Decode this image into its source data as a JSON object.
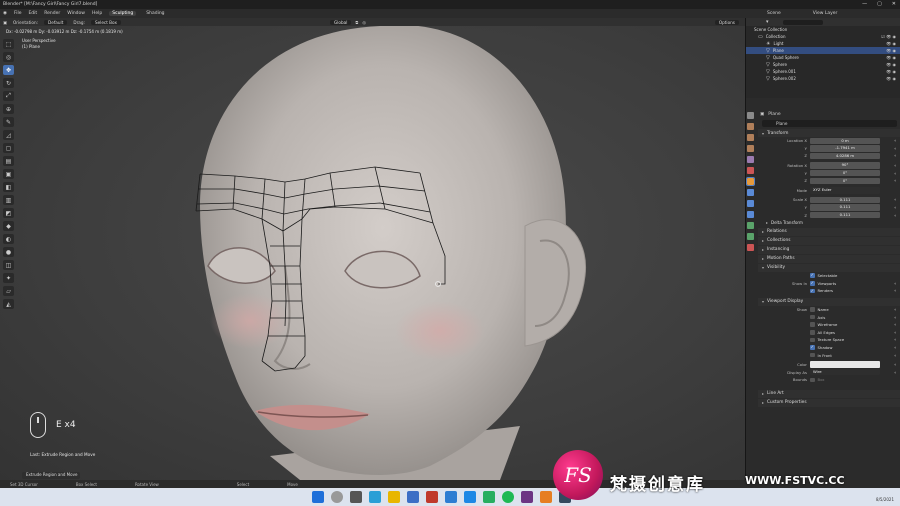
{
  "window": {
    "title": "Blender* [M:\\Fancy Girl\\Fancy Girl7.blend]",
    "controls": [
      "—",
      "▢",
      "✕"
    ]
  },
  "menu": {
    "items": [
      "File",
      "Edit",
      "Render",
      "Window",
      "Help"
    ],
    "workspaces": [
      "Sculpting",
      "Shading"
    ],
    "active_workspace": "Sculpting"
  },
  "scene_header": {
    "scene": "Scene",
    "view_layer": "View Layer"
  },
  "tool_header": {
    "orientation_label": "Orientation:",
    "orientation_value": "Default",
    "drag_label": "Drag:",
    "drag_value": "Select Box",
    "transform_orient": "Global",
    "options_label": "Options"
  },
  "viewport": {
    "status_top": "Dx: -0.02798 m   Dy: -0.03912 m   Dz: -0.1754 m (0.1819 m)",
    "perspective": "User Perspective",
    "object": "(1) Plane",
    "keycast": "E x4",
    "last_op": "Last: Extrude Region and Move",
    "op_panel": "Extrude Region and Move"
  },
  "footer": {
    "items": [
      "Set 3D Cursor",
      "Box Select",
      "Rotate View",
      "Select",
      "Move"
    ]
  },
  "outliner": {
    "root": "Scene Collection",
    "collection": "Collection",
    "items": [
      {
        "name": "Light",
        "selected": false
      },
      {
        "name": "Plane",
        "selected": true
      },
      {
        "name": "Quad Sphere",
        "selected": false
      },
      {
        "name": "Sphere",
        "selected": false
      },
      {
        "name": "Sphere.001",
        "selected": false
      },
      {
        "name": "Sphere.002",
        "selected": false
      }
    ]
  },
  "properties": {
    "header_object": "Plane",
    "object_name": "Plane",
    "transform": {
      "title": "Transform",
      "location": {
        "label": "Location X",
        "x": "0 m",
        "y": "-1.7941 m",
        "z": "4.0286 m"
      },
      "rotation": {
        "label": "Rotation X",
        "x": "90°",
        "y": "0°",
        "z": "0°"
      },
      "mode_label": "Mode",
      "mode": "XYZ Euler",
      "scale": {
        "label": "Scale X",
        "x": "0.111",
        "y": "0.111",
        "z": "0.111"
      },
      "axis_y": "Y",
      "axis_z": "Z",
      "delta": "Delta Transform"
    },
    "panels": [
      "Relations",
      "Collections",
      "Instancing",
      "Motion Paths"
    ],
    "visibility": {
      "title": "Visibility",
      "selectable": "Selectable",
      "show_in_label": "Show In",
      "viewports": "Viewports",
      "renders": "Renders"
    },
    "viewport_display": {
      "title": "Viewport Display",
      "show_label": "Show",
      "options": [
        {
          "label": "Name",
          "on": false
        },
        {
          "label": "Axis",
          "on": false
        },
        {
          "label": "Wireframe",
          "on": false
        },
        {
          "label": "All Edges",
          "on": false
        },
        {
          "label": "Texture Space",
          "on": false
        },
        {
          "label": "Shadow",
          "on": true
        },
        {
          "label": "In Front",
          "on": false
        }
      ],
      "color_label": "Color",
      "display_as_label": "Display As",
      "display_as": "Wire",
      "bounds_label": "Bounds",
      "bounds": "Box"
    },
    "bottom_panels": [
      "Line Art",
      "Custom Properties"
    ]
  },
  "watermark": {
    "logo": "FS",
    "text": "梵摄创意库",
    "url": "WWW.FSTVC.CC"
  },
  "tray": {
    "date": "8/5/2021"
  },
  "colors": {
    "accent": "#4772b3",
    "selection": "#334d80",
    "skin": "#bdb7b3",
    "wire": "#1a1a1a",
    "taskbar": "#dce3ee",
    "watermark_pink": "#e91e63"
  }
}
